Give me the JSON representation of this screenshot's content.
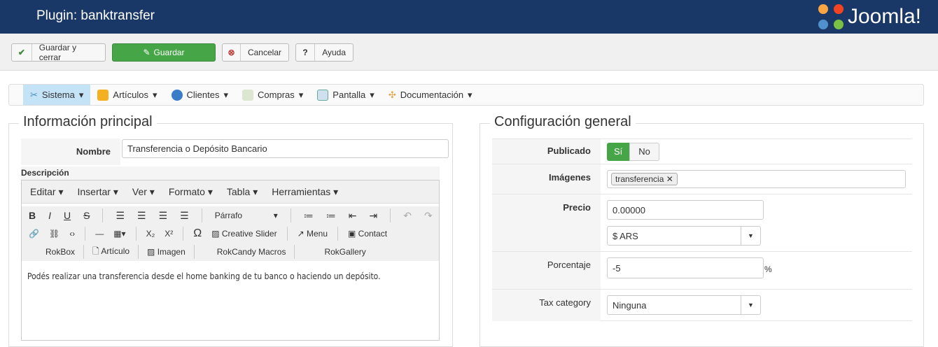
{
  "header": {
    "title": "Plugin: banktransfer",
    "logo_text": "Joomla!"
  },
  "toolbar": {
    "save_close": "Guardar y cerrar",
    "save": "Guardar",
    "cancel": "Cancelar",
    "help": "Ayuda"
  },
  "menu": [
    {
      "label": "Sistema"
    },
    {
      "label": "Artículos"
    },
    {
      "label": "Clientes"
    },
    {
      "label": "Compras"
    },
    {
      "label": "Pantalla"
    },
    {
      "label": "Documentación"
    }
  ],
  "left": {
    "legend": "Información principal",
    "name_label": "Nombre",
    "name_value": "Transferencia o Depósito Bancario",
    "desc_label": "Descripción",
    "editor": {
      "menus": [
        "Editar",
        "Insertar",
        "Ver",
        "Formato",
        "Tabla",
        "Herramientas"
      ],
      "format": "Párrafo",
      "plugins1": [
        "Creative Slider",
        "Menu",
        "Contact"
      ],
      "plugins2": [
        "RokBox",
        "Artículo",
        "Imagen",
        "RokCandy Macros",
        "RokGallery"
      ],
      "content": "Podés realizar una transferencia desde el home banking de tu banco o haciendo un depósito."
    }
  },
  "right": {
    "legend": "Configuración general",
    "published_label": "Publicado",
    "yes": "Sí",
    "no": "No",
    "images_label": "Imágenes",
    "image_tag": "transferencia",
    "price_label": "Precio",
    "price_value": "0.00000",
    "currency": "$ ARS",
    "percent_label": "Porcentaje",
    "percent_value": "-5",
    "percent_sign": "%",
    "tax_label": "Tax category",
    "tax_value": "Ninguna"
  }
}
